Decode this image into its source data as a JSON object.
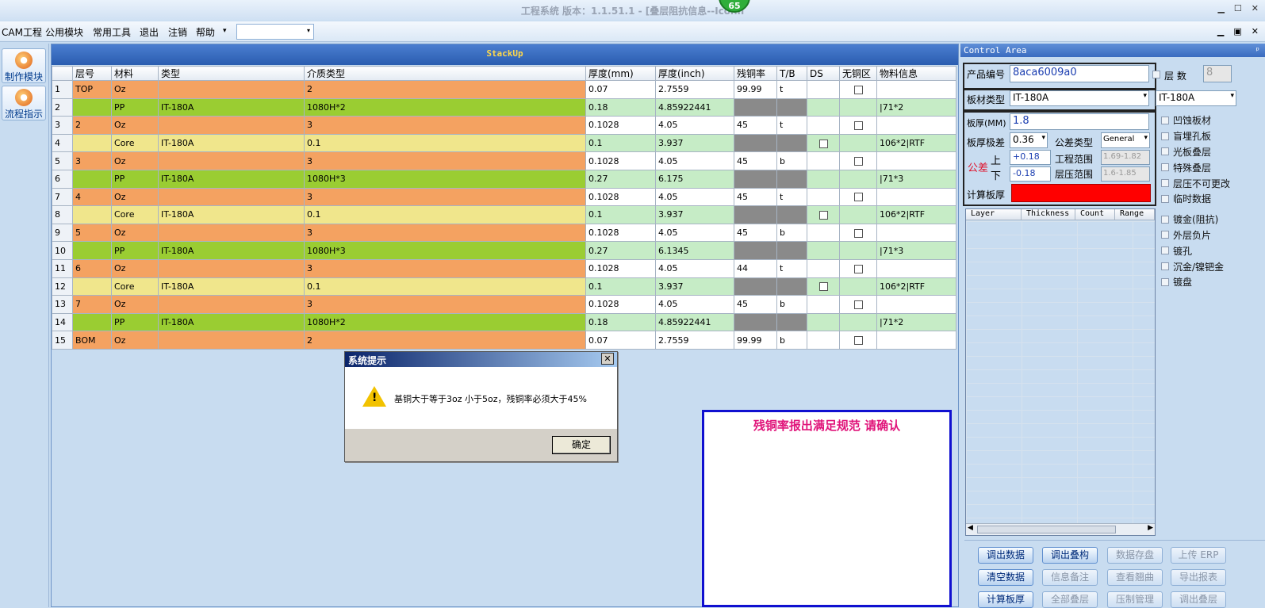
{
  "window": {
    "title": "工程系统  版本：1.1.51.1 - [叠层阻抗信息--Iconn",
    "badge": "65",
    "min": "▁",
    "max": "☐",
    "close": "✕"
  },
  "menu": {
    "items": [
      "CAM工程",
      "公用模块",
      "常用工具",
      "退出",
      "注销",
      "帮助"
    ],
    "help_arrow": "▾",
    "combo_value": "",
    "combo_arrow": "▾"
  },
  "mdi": {
    "min": "▁",
    "restore": "▣",
    "close": "✕"
  },
  "left": {
    "btn1": "制作模块",
    "btn2": "流程指示"
  },
  "stack": {
    "title": "StackUp",
    "headers": [
      "",
      "层号",
      "材料",
      "类型",
      "介质类型",
      "厚度(mm)",
      "厚度(inch)",
      "残铜率",
      "T/B",
      "DS",
      "无铜区",
      "物料信息"
    ],
    "rows": [
      [
        "1",
        "TOP",
        "Oz",
        "",
        "2",
        "0.07",
        "2.7559",
        "99.99",
        "t",
        "",
        true,
        ""
      ],
      [
        "2",
        "",
        "PP",
        "IT-180A",
        "1080H*2",
        "0.18",
        "4.85922441",
        "",
        "",
        "",
        false,
        "|71*2"
      ],
      [
        "3",
        "2",
        "Oz",
        "",
        "3",
        "0.1028",
        "4.05",
        "45",
        "t",
        "",
        true,
        ""
      ],
      [
        "4",
        "",
        "Core",
        "IT-180A",
        "0.1",
        "0.1",
        "3.937",
        "",
        "",
        "cb",
        false,
        "106*2|RTF"
      ],
      [
        "5",
        "3",
        "Oz",
        "",
        "3",
        "0.1028",
        "4.05",
        "45",
        "b",
        "",
        true,
        ""
      ],
      [
        "6",
        "",
        "PP",
        "IT-180A",
        "1080H*3",
        "0.27",
        "6.175",
        "",
        "",
        "",
        false,
        "|71*3"
      ],
      [
        "7",
        "4",
        "Oz",
        "",
        "3",
        "0.1028",
        "4.05",
        "45",
        "t",
        "",
        true,
        ""
      ],
      [
        "8",
        "",
        "Core",
        "IT-180A",
        "0.1",
        "0.1",
        "3.937",
        "",
        "",
        "cb",
        false,
        "106*2|RTF"
      ],
      [
        "9",
        "5",
        "Oz",
        "",
        "3",
        "0.1028",
        "4.05",
        "45",
        "b",
        "",
        true,
        ""
      ],
      [
        "10",
        "",
        "PP",
        "IT-180A",
        "1080H*3",
        "0.27",
        "6.1345",
        "",
        "",
        "",
        false,
        "|71*3"
      ],
      [
        "11",
        "6",
        "Oz",
        "",
        "3",
        "0.1028",
        "4.05",
        "44",
        "t",
        "",
        true,
        ""
      ],
      [
        "12",
        "",
        "Core",
        "IT-180A",
        "0.1",
        "0.1",
        "3.937",
        "",
        "",
        "cb",
        false,
        "106*2|RTF"
      ],
      [
        "13",
        "7",
        "Oz",
        "",
        "3",
        "0.1028",
        "4.05",
        "45",
        "b",
        "",
        true,
        ""
      ],
      [
        "14",
        "",
        "PP",
        "IT-180A",
        "1080H*2",
        "0.18",
        "4.85922441",
        "",
        "",
        "",
        false,
        "|71*2"
      ],
      [
        "15",
        "BOM",
        "Oz",
        "",
        "2",
        "0.07",
        "2.7559",
        "99.99",
        "b",
        "",
        true,
        ""
      ]
    ]
  },
  "dialog": {
    "title": "系统提示",
    "close": "✕",
    "icon": "!",
    "message": "基铜大于等于3oz 小于5oz，残铜率必须大于45%",
    "ok": "确定"
  },
  "notice": {
    "text": "残铜率报出满足规范   请确认"
  },
  "control": {
    "title": "Control Area",
    "pin": "ᵖ",
    "product_label": "产品编号",
    "product_value": "8aca6009a0",
    "layers_label": "层  数",
    "layers_value": "8",
    "board_type_label": "板材类型",
    "board_type_value": "IT-180A",
    "board_type_value2": "IT-180A",
    "thickness_label": "板厚(MM)",
    "thickness_value": "1.8",
    "tol_label": "板厚极差",
    "tol_value": "0.36",
    "tol_type_label": "公差类型",
    "tol_type_value": "General",
    "gongcha": "公差",
    "up": "上",
    "down": "下",
    "up_value": "+0.18",
    "down_value": "-0.18",
    "eng_range_label": "工程范围",
    "eng_range_value": "1.69-1.82",
    "press_range_label": "层压范围",
    "press_range_value": "1.6-1.85",
    "calc_label": "计算板厚",
    "table_headers": [
      "Layer",
      "Thickness",
      "Count",
      "Range"
    ],
    "checks": [
      "凹蚀板材",
      "盲埋孔板",
      "光板叠层",
      "特殊叠层",
      "层压不可更改",
      "临时数据",
      "镀金(阻抗)",
      "外层负片",
      "镀孔",
      "沉金/镍钯金",
      "镀盘"
    ],
    "buttons": [
      "调出数据",
      "调出叠构",
      "数据存盘",
      "上传 ERP",
      "清空数据",
      "信息备注",
      "查看翘曲",
      "导出报表",
      "计算板厚",
      "全部叠层",
      "压制管理",
      "调出叠层"
    ]
  }
}
